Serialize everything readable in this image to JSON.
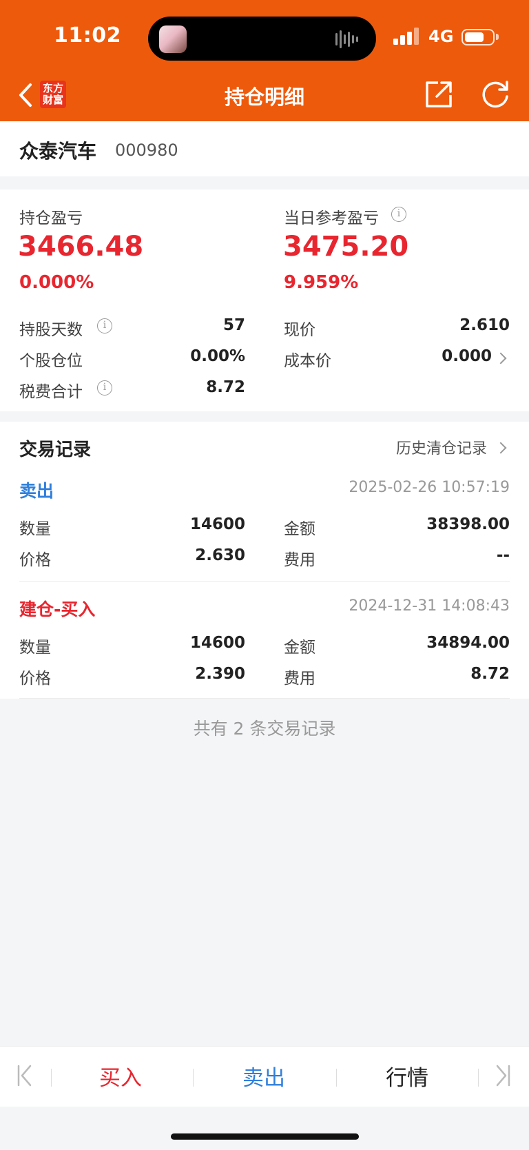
{
  "status": {
    "time": "11:02",
    "network": "4G",
    "battery_level": 0.7
  },
  "nav": {
    "logo_text": "东方\n财富",
    "logo_line1": "东方",
    "logo_line2": "财富",
    "title": "持仓明细"
  },
  "stock": {
    "name": "众泰汽车",
    "code": "000980"
  },
  "summary": {
    "holding_pl_label": "持仓盈亏",
    "holding_pl_value": "3466.48",
    "holding_pl_pct": "0.000%",
    "daily_pl_label": "当日参考盈亏",
    "daily_pl_value": "3475.20",
    "daily_pl_pct": "9.959%",
    "days_label": "持股天数",
    "days_value": "57",
    "position_label": "个股仓位",
    "position_value": "0.00%",
    "tax_label": "税费合计",
    "tax_value": "8.72",
    "price_label": "现价",
    "price_value": "2.610",
    "cost_label": "成本价",
    "cost_value": "0.000"
  },
  "trades": {
    "title": "交易记录",
    "history_link": "历史清仓记录",
    "records": [
      {
        "type": "卖出",
        "type_color": "#2f7fdc",
        "time": "2025-02-26 10:57:19",
        "qty_label": "数量",
        "qty": "14600",
        "amount_label": "金额",
        "amount": "38398.00",
        "price_label": "价格",
        "price": "2.630",
        "fee_label": "费用",
        "fee": "--"
      },
      {
        "type": "建仓-买入",
        "type_color": "#e8262f",
        "time": "2024-12-31 14:08:43",
        "qty_label": "数量",
        "qty": "14600",
        "amount_label": "金额",
        "amount": "34894.00",
        "price_label": "价格",
        "price": "2.390",
        "fee_label": "费用",
        "fee": "8.72"
      }
    ],
    "footer": "共有 2 条交易记录"
  },
  "toolbar": {
    "buy": "买入",
    "sell": "卖出",
    "quote": "行情"
  },
  "colors": {
    "header": "#ee5a0c",
    "red": "#e8262f",
    "blue": "#2f7fdc"
  }
}
